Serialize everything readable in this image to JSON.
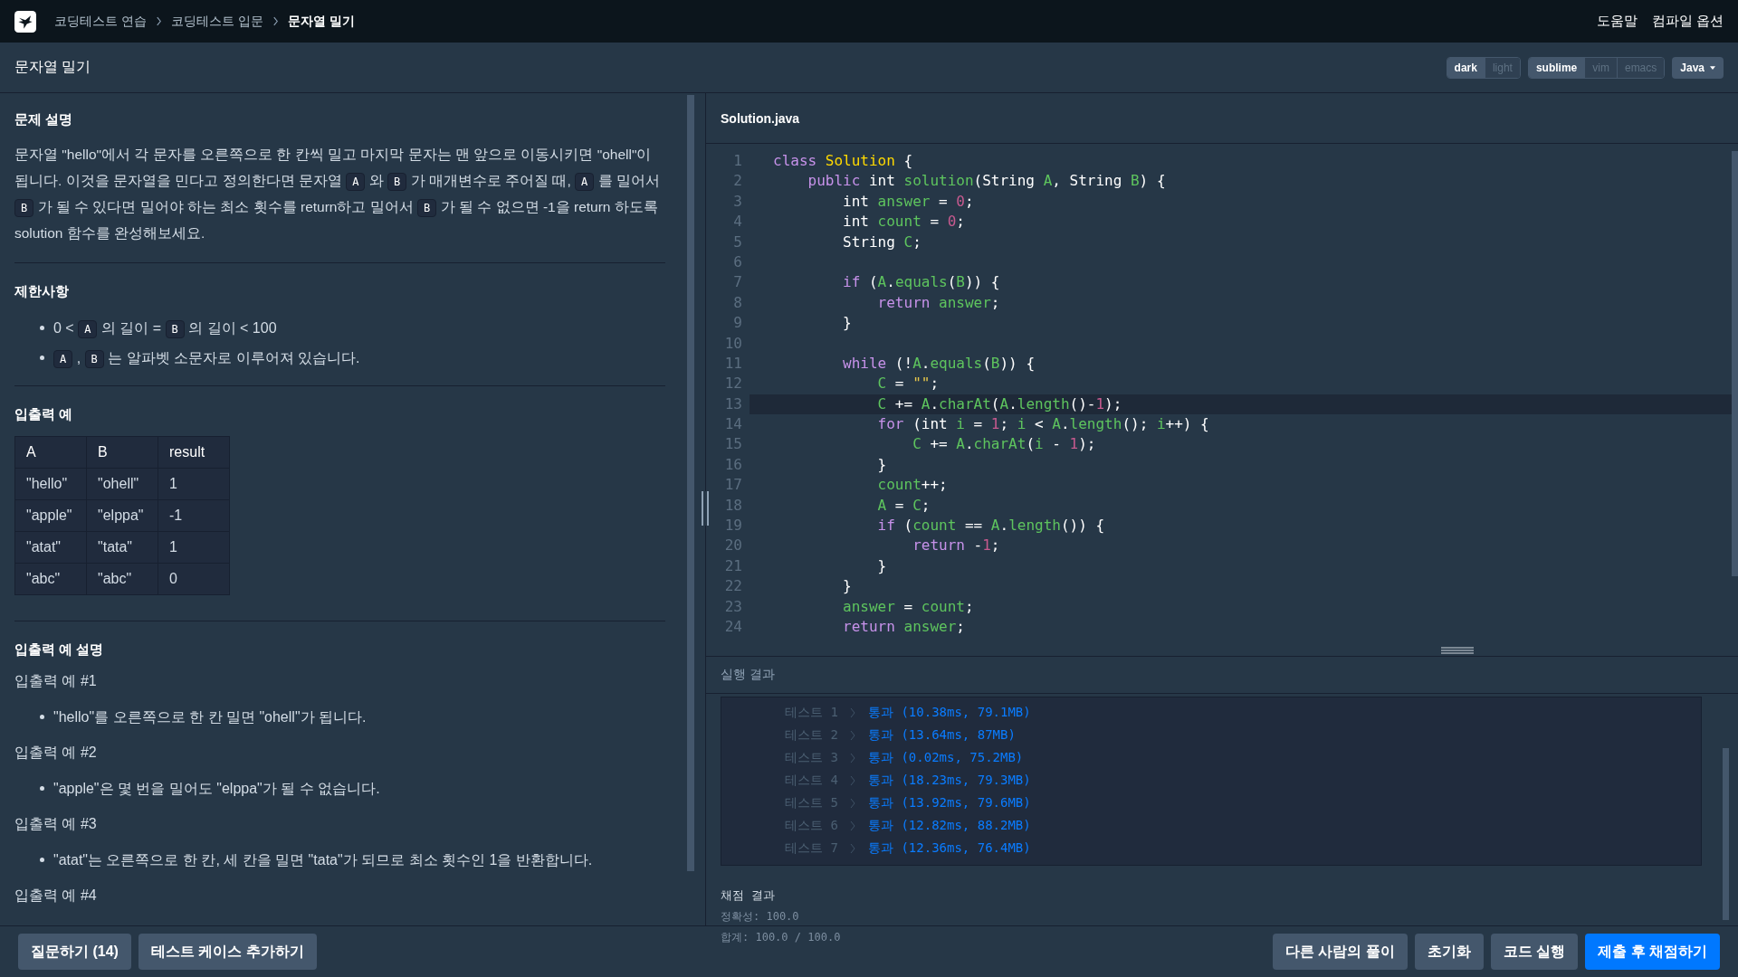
{
  "topbar": {
    "breadcrumbs": [
      {
        "label": "코딩테스트 연습",
        "current": false
      },
      {
        "label": "코딩테스트 입문",
        "current": false
      },
      {
        "label": "문자열 밀기",
        "current": true
      }
    ],
    "links": [
      "도움말",
      "컴파일 옵션"
    ]
  },
  "header": {
    "title": "문자열 밀기",
    "themes": [
      {
        "label": "dark",
        "selected": true
      },
      {
        "label": "light",
        "selected": false
      }
    ],
    "keymaps": [
      {
        "label": "sublime",
        "selected": true
      },
      {
        "label": "vim",
        "selected": false
      },
      {
        "label": "emacs",
        "selected": false
      }
    ],
    "language": "Java"
  },
  "problem": {
    "description_title": "문제 설명",
    "description": [
      {
        "kind": "text",
        "text": "문자열 \"hello\"에서 각 문자를 오른쪽으로 한 칸씩 밀고 마지막 문자는 맨 앞으로 이동시키면 \"ohell\"이 됩니다. 이것을 문자열을 민다고 정의한다면 문자열 "
      },
      {
        "kind": "code",
        "text": "A"
      },
      {
        "kind": "text",
        "text": " 와 "
      },
      {
        "kind": "code",
        "text": "B"
      },
      {
        "kind": "text",
        "text": " 가 매개변수로 주어질 때, "
      },
      {
        "kind": "code",
        "text": "A"
      },
      {
        "kind": "text",
        "text": " 를 밀어서 "
      },
      {
        "kind": "code",
        "text": "B"
      },
      {
        "kind": "text",
        "text": " 가 될 수 있다면 밀어야 하는 최소 횟수를 return하고 밀어서 "
      },
      {
        "kind": "code",
        "text": "B"
      },
      {
        "kind": "text",
        "text": " 가 될 수 없으면 -1을 return 하도록 solution 함수를 완성해보세요."
      }
    ],
    "constraints_title": "제한사항",
    "constraints": [
      [
        {
          "kind": "text",
          "text": "0 < "
        },
        {
          "kind": "code",
          "text": "A"
        },
        {
          "kind": "text",
          "text": " 의 길이 = "
        },
        {
          "kind": "code",
          "text": "B"
        },
        {
          "kind": "text",
          "text": " 의 길이 < 100"
        }
      ],
      [
        {
          "kind": "code",
          "text": "A"
        },
        {
          "kind": "text",
          "text": " , "
        },
        {
          "kind": "code",
          "text": "B"
        },
        {
          "kind": "text",
          "text": " 는 알파벳 소문자로 이루어져 있습니다."
        }
      ]
    ],
    "examples_title": "입출력 예",
    "examples_table": {
      "columns": [
        "A",
        "B",
        "result"
      ],
      "rows": [
        [
          "\"hello\"",
          "\"ohell\"",
          "1"
        ],
        [
          "\"apple\"",
          "\"elppa\"",
          "-1"
        ],
        [
          "\"atat\"",
          "\"tata\"",
          "1"
        ],
        [
          "\"abc\"",
          "\"abc\"",
          "0"
        ]
      ]
    },
    "explanation_title": "입출력 예 설명",
    "explanations": [
      {
        "title": "입출력 예 #1",
        "bullets": [
          "\"hello\"를 오른쪽으로 한 칸 밀면 \"ohell\"가 됩니다."
        ]
      },
      {
        "title": "입출력 예 #2",
        "bullets": [
          "\"apple\"은 몇 번을 밀어도 \"elppa\"가 될 수 없습니다."
        ]
      },
      {
        "title": "입출력 예 #3",
        "bullets": [
          "\"atat\"는 오른쪽으로 한 칸, 세 칸을 밀면 \"tata\"가 되므로 최소 횟수인 1을 반환합니다."
        ]
      },
      {
        "title": "입출력 예 #4"
      }
    ]
  },
  "editor": {
    "filename": "Solution.java",
    "lines": [
      {
        "number": "1",
        "highlighted": false,
        "tokens": [
          {
            "kind": "kw",
            "text": "class "
          },
          {
            "kind": "cls",
            "text": "Solution"
          },
          {
            "kind": "plain",
            "text": " {"
          }
        ]
      },
      {
        "number": "2",
        "highlighted": false,
        "tokens": [
          {
            "kind": "kw",
            "text": "    public "
          },
          {
            "kind": "plain",
            "text": "int "
          },
          {
            "kind": "var",
            "text": "solution"
          },
          {
            "kind": "plain",
            "text": "(String "
          },
          {
            "kind": "var",
            "text": "A"
          },
          {
            "kind": "plain",
            "text": ", String "
          },
          {
            "kind": "var",
            "text": "B"
          },
          {
            "kind": "plain",
            "text": ") {"
          }
        ]
      },
      {
        "number": "3",
        "highlighted": false,
        "tokens": [
          {
            "kind": "plain",
            "text": "        int "
          },
          {
            "kind": "var",
            "text": "answer"
          },
          {
            "kind": "plain",
            "text": " = "
          },
          {
            "kind": "num",
            "text": "0"
          },
          {
            "kind": "plain",
            "text": ";"
          }
        ]
      },
      {
        "number": "4",
        "highlighted": false,
        "tokens": [
          {
            "kind": "plain",
            "text": "        int "
          },
          {
            "kind": "var",
            "text": "count"
          },
          {
            "kind": "plain",
            "text": " = "
          },
          {
            "kind": "num",
            "text": "0"
          },
          {
            "kind": "plain",
            "text": ";"
          }
        ]
      },
      {
        "number": "5",
        "highlighted": false,
        "tokens": [
          {
            "kind": "plain",
            "text": "        String "
          },
          {
            "kind": "var",
            "text": "C"
          },
          {
            "kind": "plain",
            "text": ";"
          }
        ]
      },
      {
        "number": "6",
        "highlighted": false
      },
      {
        "number": "7",
        "highlighted": false,
        "tokens": [
          {
            "kind": "kw",
            "text": "        if "
          },
          {
            "kind": "plain",
            "text": "("
          },
          {
            "kind": "var",
            "text": "A"
          },
          {
            "kind": "plain",
            "text": "."
          },
          {
            "kind": "var",
            "text": "equals"
          },
          {
            "kind": "plain",
            "text": "("
          },
          {
            "kind": "var",
            "text": "B"
          },
          {
            "kind": "plain",
            "text": ")) {"
          }
        ]
      },
      {
        "number": "8",
        "highlighted": false,
        "tokens": [
          {
            "kind": "kw",
            "text": "            return "
          },
          {
            "kind": "var",
            "text": "answer"
          },
          {
            "kind": "plain",
            "text": ";"
          }
        ]
      },
      {
        "number": "9",
        "highlighted": false,
        "tokens": [
          {
            "kind": "plain",
            "text": "        }"
          }
        ]
      },
      {
        "number": "10",
        "highlighted": false
      },
      {
        "number": "11",
        "highlighted": false,
        "tokens": [
          {
            "kind": "kw",
            "text": "        while "
          },
          {
            "kind": "plain",
            "text": "(!"
          },
          {
            "kind": "var",
            "text": "A"
          },
          {
            "kind": "plain",
            "text": "."
          },
          {
            "kind": "var",
            "text": "equals"
          },
          {
            "kind": "plain",
            "text": "("
          },
          {
            "kind": "var",
            "text": "B"
          },
          {
            "kind": "plain",
            "text": ")) {"
          }
        ]
      },
      {
        "number": "12",
        "highlighted": false,
        "tokens": [
          {
            "kind": "var",
            "text": "            C"
          },
          {
            "kind": "plain",
            "text": " = "
          },
          {
            "kind": "str",
            "text": "\"\""
          },
          {
            "kind": "plain",
            "text": ";"
          }
        ]
      },
      {
        "number": "13",
        "highlighted": true,
        "tokens": [
          {
            "kind": "var",
            "text": "            C"
          },
          {
            "kind": "plain",
            "text": " += "
          },
          {
            "kind": "var",
            "text": "A"
          },
          {
            "kind": "plain",
            "text": "."
          },
          {
            "kind": "var",
            "text": "charAt"
          },
          {
            "kind": "plain",
            "text": "("
          },
          {
            "kind": "var",
            "text": "A"
          },
          {
            "kind": "plain",
            "text": "."
          },
          {
            "kind": "var",
            "text": "length"
          },
          {
            "kind": "plain",
            "text": "()-"
          },
          {
            "kind": "num",
            "text": "1"
          },
          {
            "kind": "plain",
            "text": ");"
          }
        ]
      },
      {
        "number": "14",
        "highlighted": false,
        "tokens": [
          {
            "kind": "kw",
            "text": "            for "
          },
          {
            "kind": "plain",
            "text": "(int "
          },
          {
            "kind": "var",
            "text": "i"
          },
          {
            "kind": "plain",
            "text": " = "
          },
          {
            "kind": "num",
            "text": "1"
          },
          {
            "kind": "plain",
            "text": "; "
          },
          {
            "kind": "var",
            "text": "i"
          },
          {
            "kind": "plain",
            "text": " < "
          },
          {
            "kind": "var",
            "text": "A"
          },
          {
            "kind": "plain",
            "text": "."
          },
          {
            "kind": "var",
            "text": "length"
          },
          {
            "kind": "plain",
            "text": "(); "
          },
          {
            "kind": "var",
            "text": "i"
          },
          {
            "kind": "plain",
            "text": "++) {"
          }
        ]
      },
      {
        "number": "15",
        "highlighted": false,
        "tokens": [
          {
            "kind": "var",
            "text": "                C"
          },
          {
            "kind": "plain",
            "text": " += "
          },
          {
            "kind": "var",
            "text": "A"
          },
          {
            "kind": "plain",
            "text": "."
          },
          {
            "kind": "var",
            "text": "charAt"
          },
          {
            "kind": "plain",
            "text": "("
          },
          {
            "kind": "var",
            "text": "i"
          },
          {
            "kind": "plain",
            "text": " - "
          },
          {
            "kind": "num",
            "text": "1"
          },
          {
            "kind": "plain",
            "text": ");"
          }
        ]
      },
      {
        "number": "16",
        "highlighted": false,
        "tokens": [
          {
            "kind": "plain",
            "text": "            }"
          }
        ]
      },
      {
        "number": "17",
        "highlighted": false,
        "tokens": [
          {
            "kind": "var",
            "text": "            count"
          },
          {
            "kind": "plain",
            "text": "++;"
          }
        ]
      },
      {
        "number": "18",
        "highlighted": false,
        "tokens": [
          {
            "kind": "var",
            "text": "            A"
          },
          {
            "kind": "plain",
            "text": " = "
          },
          {
            "kind": "var",
            "text": "C"
          },
          {
            "kind": "plain",
            "text": ";"
          }
        ]
      },
      {
        "number": "19",
        "highlighted": false,
        "tokens": [
          {
            "kind": "kw",
            "text": "            if "
          },
          {
            "kind": "plain",
            "text": "("
          },
          {
            "kind": "var",
            "text": "count"
          },
          {
            "kind": "plain",
            "text": " == "
          },
          {
            "kind": "var",
            "text": "A"
          },
          {
            "kind": "plain",
            "text": "."
          },
          {
            "kind": "var",
            "text": "length"
          },
          {
            "kind": "plain",
            "text": "()) {"
          }
        ]
      },
      {
        "number": "20",
        "highlighted": false,
        "tokens": [
          {
            "kind": "kw",
            "text": "                return "
          },
          {
            "kind": "plain",
            "text": "-"
          },
          {
            "kind": "num",
            "text": "1"
          },
          {
            "kind": "plain",
            "text": ";"
          }
        ]
      },
      {
        "number": "21",
        "highlighted": false,
        "tokens": [
          {
            "kind": "plain",
            "text": "            }"
          }
        ]
      },
      {
        "number": "22",
        "highlighted": false,
        "tokens": [
          {
            "kind": "plain",
            "text": "        }"
          }
        ]
      },
      {
        "number": "23",
        "highlighted": false,
        "tokens": [
          {
            "kind": "var",
            "text": "        answer"
          },
          {
            "kind": "plain",
            "text": " = "
          },
          {
            "kind": "var",
            "text": "count"
          },
          {
            "kind": "plain",
            "text": ";"
          }
        ]
      },
      {
        "number": "24",
        "highlighted": false,
        "tokens": [
          {
            "kind": "kw",
            "text": "        return "
          },
          {
            "kind": "var",
            "text": "answer"
          },
          {
            "kind": "plain",
            "text": ";"
          }
        ]
      }
    ]
  },
  "results": {
    "title": "실행 결과",
    "tests": [
      {
        "label": "테스트 1",
        "result": "통과 (10.38ms, 79.1MB)"
      },
      {
        "label": "테스트 2",
        "result": "통과 (13.64ms, 87MB)"
      },
      {
        "label": "테스트 3",
        "result": "통과 (0.02ms, 75.2MB)"
      },
      {
        "label": "테스트 4",
        "result": "통과 (18.23ms, 79.3MB)"
      },
      {
        "label": "테스트 5",
        "result": "통과 (13.92ms, 79.6MB)"
      },
      {
        "label": "테스트 6",
        "result": "통과 (12.82ms, 88.2MB)"
      },
      {
        "label": "테스트 7",
        "result": "통과 (12.36ms, 76.4MB)"
      }
    ],
    "grading_title": "채점 결과",
    "grading": [
      "정확성: 100.0",
      "합계: 100.0 / 100.0"
    ]
  },
  "bottom": {
    "left_buttons": [
      {
        "label": "질문하기 (14)",
        "kind": "secondary"
      },
      {
        "label": "테스트 케이스 추가하기",
        "kind": "secondary"
      }
    ],
    "right_buttons": [
      {
        "label": "다른 사람의 풀이",
        "kind": "secondary"
      },
      {
        "label": "초기화",
        "kind": "secondary"
      },
      {
        "label": "코드 실행",
        "kind": "secondary"
      },
      {
        "label": "제출 후 채점하기",
        "kind": "primary"
      }
    ]
  }
}
